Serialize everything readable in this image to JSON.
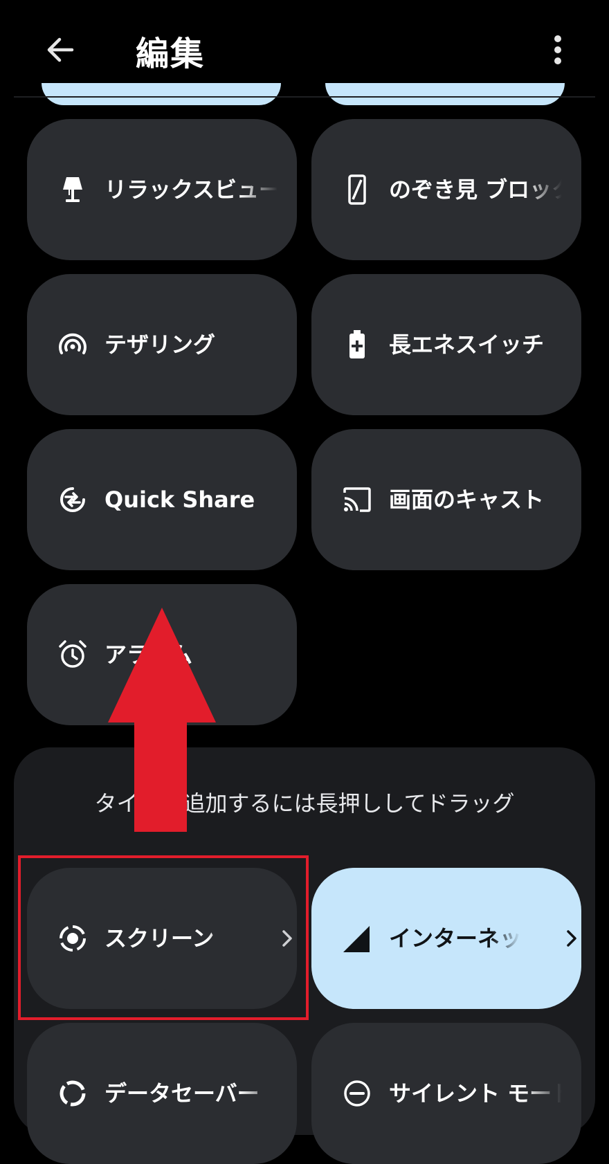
{
  "header": {
    "title": "編集",
    "back_icon": "arrow-left-icon",
    "menu_icon": "more-vertical-icon"
  },
  "tiles": [
    {
      "label": "リラックスビュー",
      "icon": "lamp-icon"
    },
    {
      "label": "のぞき見 ブロック",
      "icon": "phone-privacy-icon"
    },
    {
      "label": "テザリング",
      "icon": "hotspot-icon"
    },
    {
      "label": "長エネスイッチ",
      "icon": "battery-plus-icon"
    },
    {
      "label": "Quick Share",
      "icon": "quick-share-icon"
    },
    {
      "label": "画面のキャスト",
      "icon": "cast-icon"
    },
    {
      "label": "アラーム",
      "icon": "alarm-icon"
    }
  ],
  "available": {
    "hint": "タイルを追加するには長押ししてドラッグ",
    "tiles": [
      {
        "label": "スクリーン",
        "icon": "screen-record-icon",
        "has_chevron": true
      },
      {
        "label": "インターネット",
        "icon": "signal-icon",
        "has_chevron": true,
        "active": true
      },
      {
        "label": "データセーバー",
        "icon": "data-saver-icon"
      },
      {
        "label": "サイレント モード",
        "icon": "do-not-disturb-icon"
      }
    ]
  },
  "colors": {
    "background": "#000000",
    "tile": "#2b2d31",
    "tile_active": "#c6e6fb",
    "panel": "#1b1c1f",
    "annotation_red": "#e21d2b"
  }
}
